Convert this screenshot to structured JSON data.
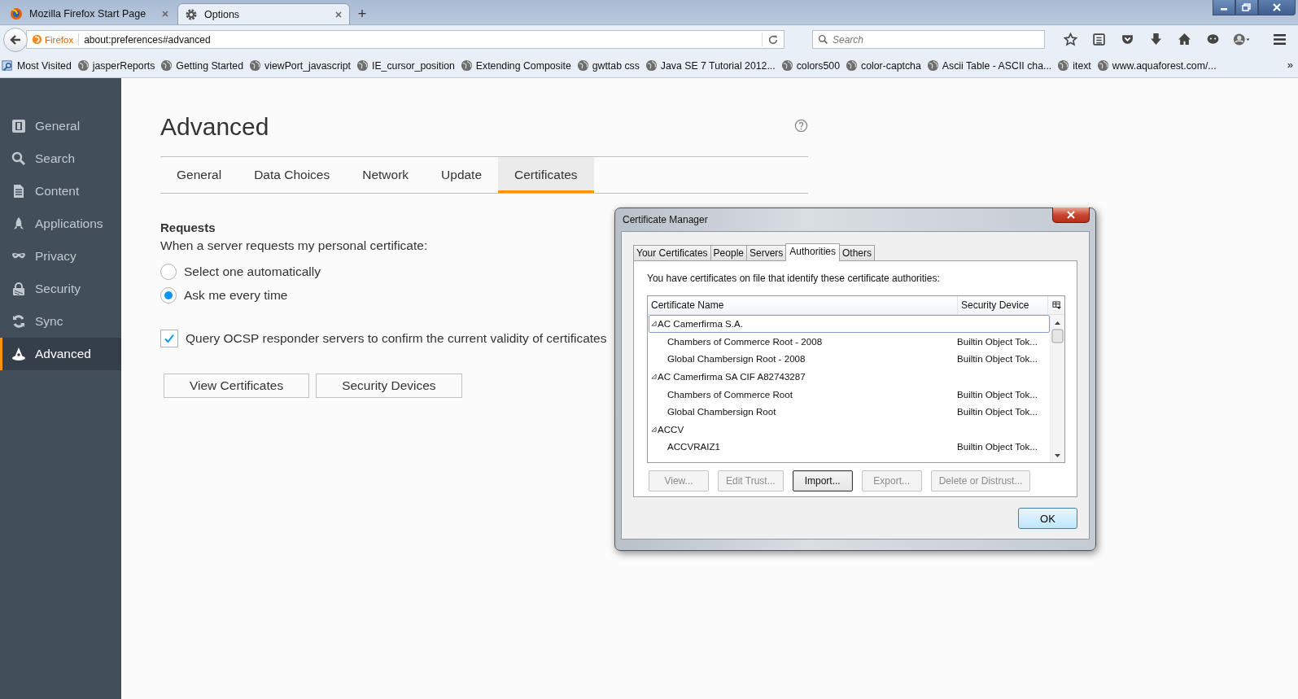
{
  "browser_tabs": [
    {
      "title": "Mozilla Firefox Start Page",
      "selected": false
    },
    {
      "title": "Options",
      "selected": true
    }
  ],
  "new_tab": "+",
  "url_bar": {
    "identity": "Firefox",
    "value": "about:preferences#advanced"
  },
  "search": {
    "placeholder": "Search"
  },
  "bookmarks": [
    {
      "label": "Most Visited",
      "kind": "folder"
    },
    {
      "label": "jasperReports",
      "kind": "page"
    },
    {
      "label": "Getting Started",
      "kind": "page"
    },
    {
      "label": "viewPort_javascript",
      "kind": "page"
    },
    {
      "label": "IE_cursor_position",
      "kind": "page"
    },
    {
      "label": "Extending Composite",
      "kind": "page"
    },
    {
      "label": "gwttab css",
      "kind": "page"
    },
    {
      "label": "Java SE 7 Tutorial 2012...",
      "kind": "page"
    },
    {
      "label": "colors500",
      "kind": "page"
    },
    {
      "label": "color-captcha",
      "kind": "page"
    },
    {
      "label": "Ascii Table - ASCII cha...",
      "kind": "page"
    },
    {
      "label": "itext",
      "kind": "page"
    },
    {
      "label": "www.aquaforest.com/...",
      "kind": "page"
    }
  ],
  "bookmarks_overflow": "»",
  "sidebar": {
    "items": [
      {
        "label": "General",
        "selected": false
      },
      {
        "label": "Search",
        "selected": false
      },
      {
        "label": "Content",
        "selected": false
      },
      {
        "label": "Applications",
        "selected": false
      },
      {
        "label": "Privacy",
        "selected": false
      },
      {
        "label": "Security",
        "selected": false
      },
      {
        "label": "Sync",
        "selected": false
      },
      {
        "label": "Advanced",
        "selected": true
      }
    ]
  },
  "page": {
    "title": "Advanced",
    "tabs": [
      {
        "label": "General",
        "selected": false
      },
      {
        "label": "Data Choices",
        "selected": false
      },
      {
        "label": "Network",
        "selected": false
      },
      {
        "label": "Update",
        "selected": false
      },
      {
        "label": "Certificates",
        "selected": true
      }
    ],
    "requests": {
      "heading": "Requests",
      "prompt": "When a server requests my personal certificate:",
      "options": [
        {
          "label": "Select one automatically",
          "selected": false
        },
        {
          "label": "Ask me every time",
          "selected": true
        }
      ]
    },
    "ocsp": {
      "label": "Query OCSP responder servers to confirm the current validity of certificates",
      "checked": true
    },
    "buttons": [
      "View Certificates",
      "Security Devices"
    ]
  },
  "dialog": {
    "title": "Certificate Manager",
    "tabs": [
      {
        "label": "Your Certificates",
        "selected": false
      },
      {
        "label": "People",
        "selected": false
      },
      {
        "label": "Servers",
        "selected": false
      },
      {
        "label": "Authorities",
        "selected": true
      },
      {
        "label": "Others",
        "selected": false
      }
    ],
    "description": "You have certificates on file that identify these certificate authorities:",
    "columns": [
      "Certificate Name",
      "Security Device"
    ],
    "rows": [
      {
        "name": "AC Camerfirma S.A.",
        "expanded": true,
        "selected": true,
        "children": [
          {
            "name": "Chambers of Commerce Root - 2008",
            "device": "Builtin Object Tok...",
            "selected": false
          },
          {
            "name": "Global Chambersign Root - 2008",
            "device": "Builtin Object Tok...",
            "selected": false
          }
        ]
      },
      {
        "name": "AC Camerfirma SA CIF A82743287",
        "expanded": true,
        "selected": false,
        "children": [
          {
            "name": "Chambers of Commerce Root",
            "device": "Builtin Object Tok...",
            "selected": false
          },
          {
            "name": "Global Chambersign Root",
            "device": "Builtin Object Tok...",
            "selected": false
          }
        ]
      },
      {
        "name": "ACCV",
        "expanded": true,
        "selected": false,
        "children": [
          {
            "name": "ACCVRAIZ1",
            "device": "Builtin Object Tok...",
            "selected": false
          }
        ]
      }
    ],
    "buttons": [
      {
        "label": "View...",
        "disabled": true,
        "focused": false
      },
      {
        "label": "Edit Trust...",
        "disabled": true,
        "focused": false
      },
      {
        "label": "Import...",
        "disabled": false,
        "focused": true
      },
      {
        "label": "Export...",
        "disabled": true,
        "focused": false
      },
      {
        "label": "Delete or Distrust...",
        "disabled": true,
        "focused": false
      }
    ],
    "ok": "OK"
  }
}
